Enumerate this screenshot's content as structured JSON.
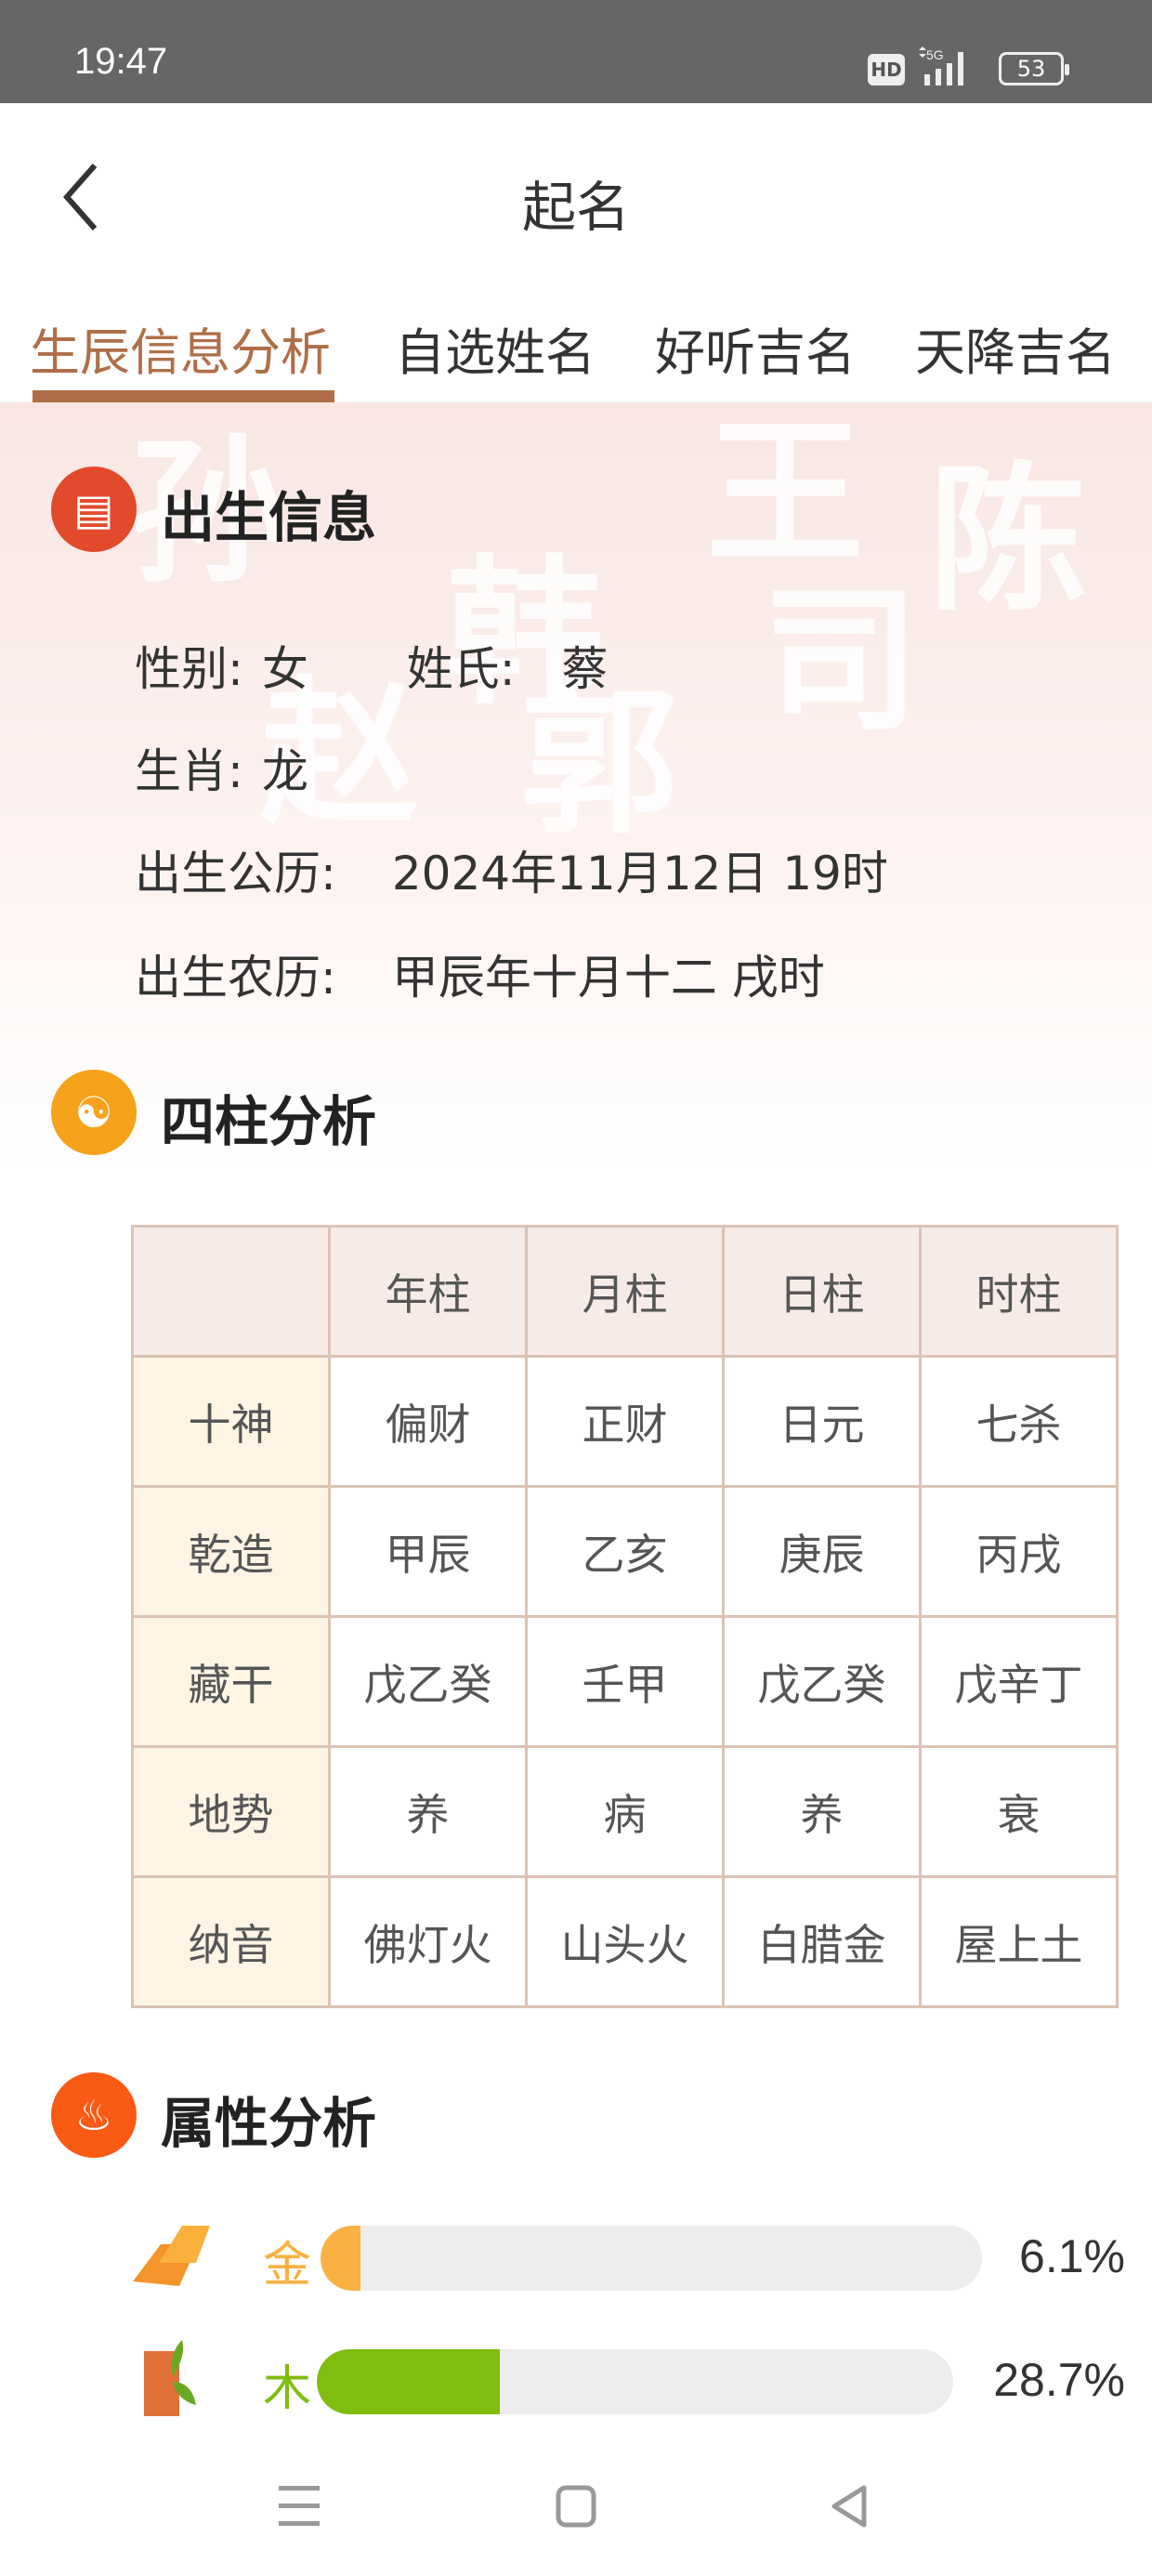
{
  "status_bar": {
    "time": "19:47",
    "hd": "HD",
    "network": "5G",
    "battery": "53"
  },
  "header": {
    "title": "起名"
  },
  "tabs": [
    {
      "label": "生辰信息分析",
      "active": true
    },
    {
      "label": "自选姓名"
    },
    {
      "label": "好听吉名"
    },
    {
      "label": "天降吉名"
    }
  ],
  "birth": {
    "title": "出生信息",
    "gender_label": "性别:",
    "gender": "女",
    "surname_label": "姓氏:",
    "surname": "蔡",
    "zodiac_label": "生肖:",
    "zodiac": "龙",
    "solar_label": "出生公历:",
    "solar": "2024年11月12日 19时",
    "lunar_label": "出生农历:",
    "lunar": "甲辰年十月十二 戌时"
  },
  "pillars": {
    "title": "四柱分析",
    "columns": [
      "",
      "年柱",
      "月柱",
      "日柱",
      "时柱"
    ],
    "rows": [
      [
        "十神",
        "偏财",
        "正财",
        "日元",
        "七杀"
      ],
      [
        "乾造",
        "甲辰",
        "乙亥",
        "庚辰",
        "丙戌"
      ],
      [
        "藏干",
        "戊乙癸",
        "壬甲",
        "戊乙癸",
        "戊辛丁"
      ],
      [
        "地势",
        "养",
        "病",
        "养",
        "衰"
      ],
      [
        "纳音",
        "佛灯火",
        "山头火",
        "白腊金",
        "屋上土"
      ]
    ]
  },
  "attributes": {
    "title": "属性分析",
    "items": [
      {
        "label": "金",
        "percent": 6.1,
        "percent_text": "6.1%",
        "color": "#f9b141",
        "icon": "gold-bar-icon"
      },
      {
        "label": "木",
        "percent": 28.7,
        "percent_text": "28.7%",
        "color": "#80bd0e",
        "icon": "wood-log-icon"
      }
    ]
  },
  "colors": {
    "accent": "#b06e48",
    "track": "#efedeb"
  }
}
